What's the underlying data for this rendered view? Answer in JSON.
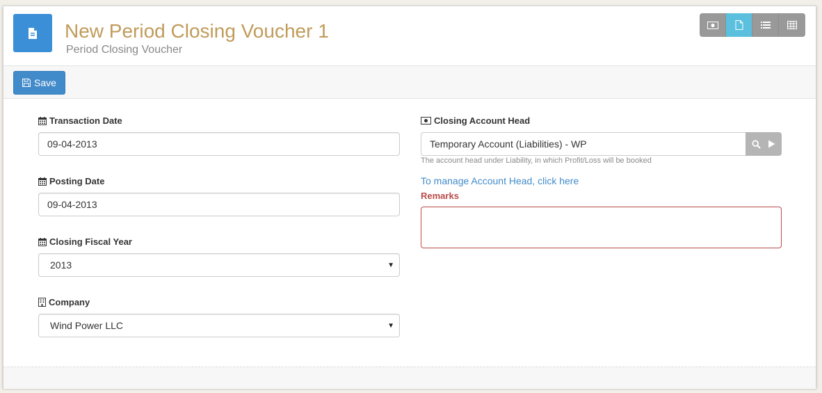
{
  "header": {
    "title": "New Period Closing Voucher 1",
    "subtitle": "Period Closing Voucher",
    "doc_icon": "file-text-icon",
    "accent": "#c09b5a",
    "view_switch": [
      {
        "icon": "money-icon",
        "active": false
      },
      {
        "icon": "file-icon",
        "active": true
      },
      {
        "icon": "list-icon",
        "active": false
      },
      {
        "icon": "table-icon",
        "active": false
      }
    ]
  },
  "toolbar": {
    "save_label": "Save",
    "save_icon": "floppy-icon",
    "primary_color": "#428bca"
  },
  "form": {
    "transaction_date": {
      "label": "Transaction Date",
      "value": "09-04-2013",
      "icon": "calendar-icon"
    },
    "posting_date": {
      "label": "Posting Date",
      "value": "09-04-2013",
      "icon": "calendar-icon"
    },
    "closing_fiscal_year": {
      "label": "Closing Fiscal Year",
      "value": "2013",
      "icon": "calendar-icon"
    },
    "company": {
      "label": "Company",
      "value": "Wind Power LLC",
      "icon": "building-icon"
    },
    "closing_account_head": {
      "label": "Closing Account Head",
      "value": "Temporary Account (Liabilities) - WP",
      "icon": "money-icon",
      "help": "The account head under Liability, in which Profit/Loss will be booked",
      "manage_link": "To manage Account Head, click here"
    },
    "remarks": {
      "label": "Remarks",
      "value": "",
      "error_color": "#b94a48"
    }
  }
}
